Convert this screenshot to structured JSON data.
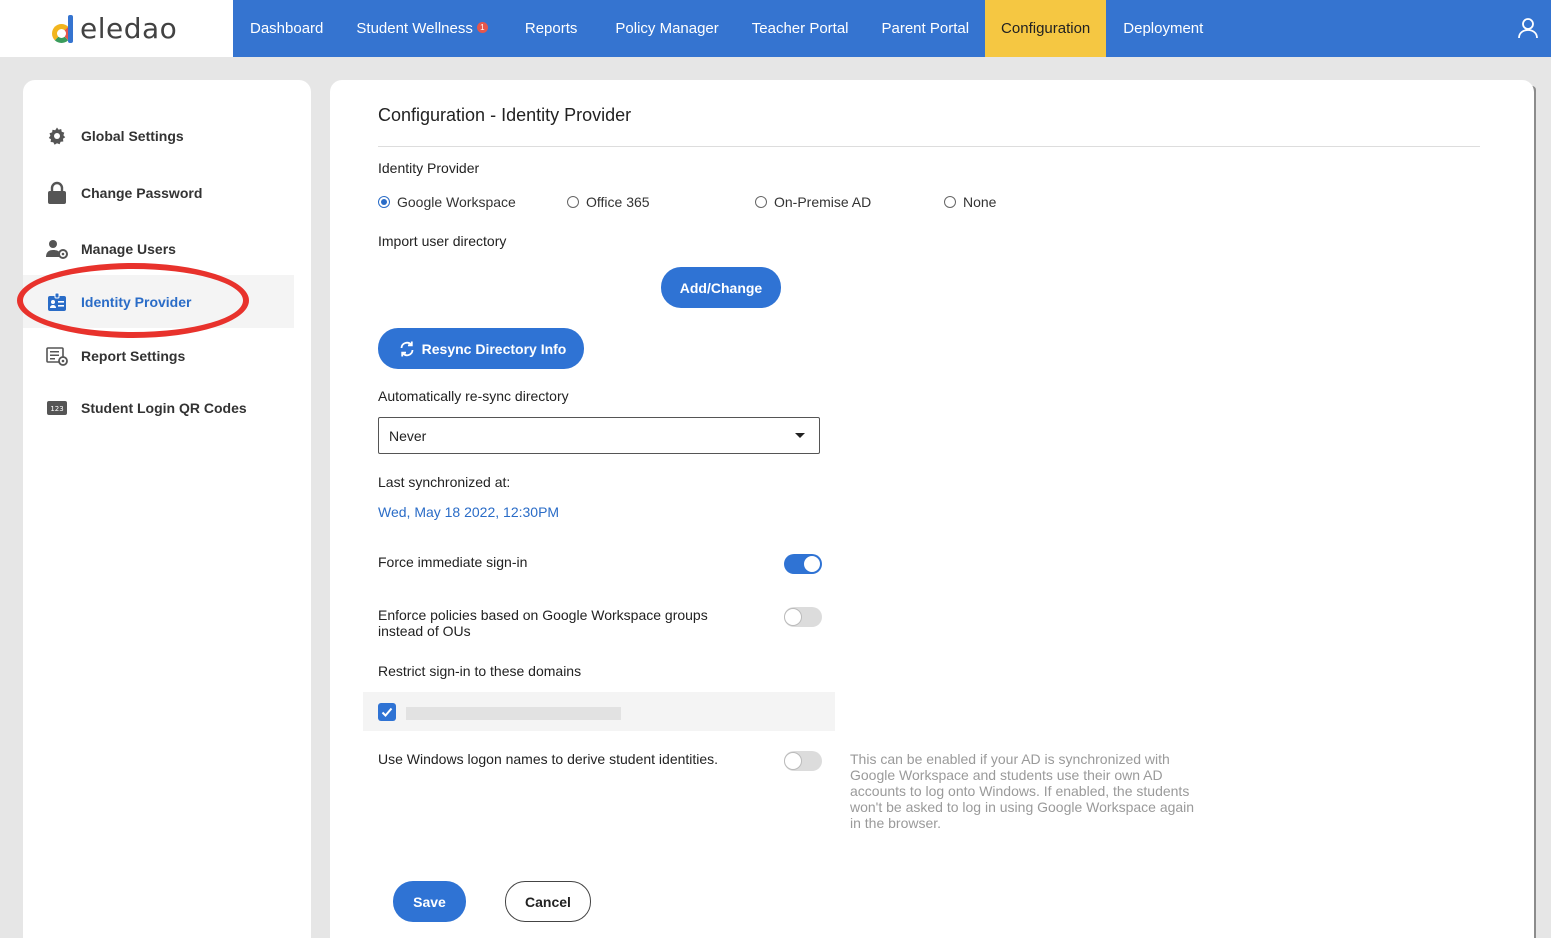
{
  "brand": {
    "logo_text": "eledao",
    "colors": {
      "nav_bg": "#3574d0",
      "active_tab": "#f5c742",
      "accent": "#2f73d4",
      "highlight": "#e8322c"
    }
  },
  "nav": {
    "items": [
      {
        "label": "Dashboard"
      },
      {
        "label": "Student Wellness",
        "badge": "1"
      },
      {
        "label": "Reports"
      },
      {
        "label": "Policy Manager"
      },
      {
        "label": "Teacher Portal"
      },
      {
        "label": "Parent Portal"
      },
      {
        "label": "Configuration",
        "active": true
      },
      {
        "label": "Deployment"
      }
    ],
    "user_icon": "user-icon"
  },
  "sidebar": {
    "items": [
      {
        "label": "Global Settings",
        "icon": "gear-icon"
      },
      {
        "label": "Change Password",
        "icon": "lock-icon"
      },
      {
        "label": "Manage Users",
        "icon": "user-gear-icon"
      },
      {
        "label": "Identity Provider",
        "icon": "id-badge-icon",
        "active": true
      },
      {
        "label": "Report Settings",
        "icon": "report-settings-icon"
      },
      {
        "label": "Student Login QR Codes",
        "icon": "qr-codes-icon"
      }
    ]
  },
  "main": {
    "title": "Configuration - Identity Provider",
    "identity_provider_label": "Identity Provider",
    "providers": [
      {
        "label": "Google Workspace",
        "selected": true
      },
      {
        "label": "Office 365",
        "selected": false
      },
      {
        "label": "On-Premise AD",
        "selected": false
      },
      {
        "label": "None",
        "selected": false
      }
    ],
    "import_label": "Import user directory",
    "add_change_label": "Add/Change",
    "resync_label": "Resync Directory Info",
    "auto_resync_label": "Automatically re-sync directory",
    "auto_resync_value": "Never",
    "last_sync_label": "Last synchronized at:",
    "last_sync_value": "Wed, May 18 2022, 12:30PM",
    "force_signin_label": "Force immediate sign-in",
    "force_signin_on": true,
    "enforce_groups_label": "Enforce policies based on Google Workspace groups instead of OUs",
    "enforce_groups_on": false,
    "restrict_domains_label": "Restrict sign-in to these domains",
    "domain_checked": true,
    "windows_logon_label": "Use Windows logon names to derive student identities.",
    "windows_logon_on": false,
    "windows_logon_help": "This can be enabled if your AD is synchronized with Google Workspace and students use their own AD accounts to log onto Windows. If enabled, the students won't be asked to log in using Google Workspace again in the browser.",
    "save_label": "Save",
    "cancel_label": "Cancel"
  }
}
